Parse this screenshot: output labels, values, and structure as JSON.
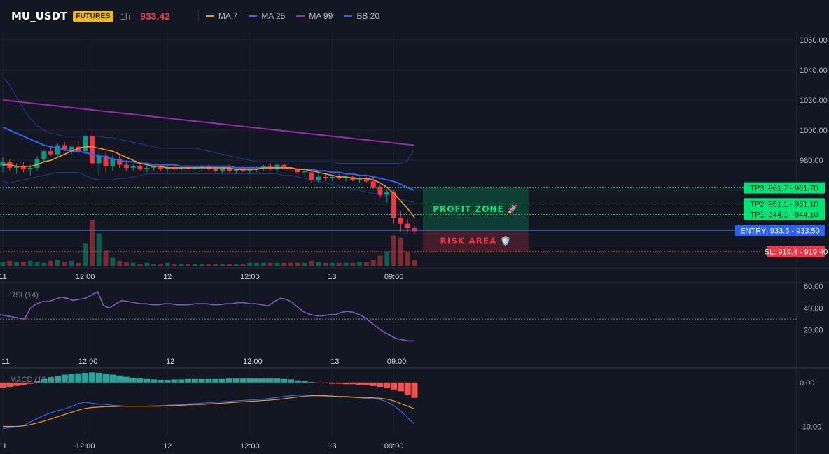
{
  "header": {
    "symbol": "MU_USDT",
    "badge": "FUTURES",
    "timeframe": "1h",
    "price": "933.42",
    "legend": [
      {
        "label": "MA 7",
        "color": "#f7931a"
      },
      {
        "label": "MA 25",
        "color": "#2962ff"
      },
      {
        "label": "MA 99",
        "color": "#9c27b0"
      },
      {
        "label": "BB 20",
        "color": "#2962ff"
      }
    ]
  },
  "colors": {
    "up": "#089981",
    "down": "#f23645",
    "volume_up": "#0b5e52",
    "volume_down": "#7a2a33",
    "ma7": "#f7931a",
    "ma25": "#2962ff",
    "ma99": "#9c27b0",
    "bb": "#1e3a8a",
    "rsi": "#7e57c2",
    "macd": "#2962ff",
    "signal": "#f7931a",
    "tp": "#00e676",
    "entry": "#2962ff",
    "sl": "#f23645"
  },
  "chart_data": [
    {
      "type": "candlestick",
      "panel": "price",
      "ylim": [
        910,
        1065
      ],
      "y_ticks": [
        960,
        980,
        1000,
        1020,
        1040,
        1060
      ],
      "y_tick_labels": [
        "960.00",
        "980.00",
        "1000.00",
        "1020.00",
        "1040.00",
        "1060.00"
      ],
      "x_tick_labels": [
        {
          "label": "11",
          "bar": 0
        },
        {
          "label": "12:00",
          "bar": 12
        },
        {
          "label": "12",
          "bar": 24
        },
        {
          "label": "12:00",
          "bar": 36
        },
        {
          "label": "13",
          "bar": 48
        },
        {
          "label": "09:00",
          "bar": 57
        }
      ],
      "candles": [
        {
          "o": 976,
          "h": 982,
          "l": 972,
          "c": 979
        },
        {
          "o": 979,
          "h": 981,
          "l": 973,
          "c": 975
        },
        {
          "o": 975,
          "h": 978,
          "l": 971,
          "c": 976
        },
        {
          "o": 976,
          "h": 979,
          "l": 972,
          "c": 974
        },
        {
          "o": 974,
          "h": 977,
          "l": 970,
          "c": 975
        },
        {
          "o": 975,
          "h": 983,
          "l": 973,
          "c": 981
        },
        {
          "o": 981,
          "h": 987,
          "l": 979,
          "c": 986
        },
        {
          "o": 986,
          "h": 989,
          "l": 983,
          "c": 984
        },
        {
          "o": 984,
          "h": 991,
          "l": 982,
          "c": 990
        },
        {
          "o": 990,
          "h": 992,
          "l": 986,
          "c": 987
        },
        {
          "o": 987,
          "h": 990,
          "l": 984,
          "c": 989
        },
        {
          "o": 989,
          "h": 993,
          "l": 984,
          "c": 986
        },
        {
          "o": 986,
          "h": 999,
          "l": 984,
          "c": 996
        },
        {
          "o": 996,
          "h": 1000,
          "l": 975,
          "c": 978
        },
        {
          "o": 978,
          "h": 988,
          "l": 970,
          "c": 983
        },
        {
          "o": 983,
          "h": 986,
          "l": 972,
          "c": 976
        },
        {
          "o": 976,
          "h": 983,
          "l": 973,
          "c": 981
        },
        {
          "o": 981,
          "h": 983,
          "l": 975,
          "c": 977
        },
        {
          "o": 977,
          "h": 980,
          "l": 973,
          "c": 975
        },
        {
          "o": 975,
          "h": 978,
          "l": 973,
          "c": 976
        },
        {
          "o": 976,
          "h": 978,
          "l": 973,
          "c": 974
        },
        {
          "o": 974,
          "h": 977,
          "l": 972,
          "c": 975
        },
        {
          "o": 975,
          "h": 977,
          "l": 973,
          "c": 976
        },
        {
          "o": 976,
          "h": 977,
          "l": 973,
          "c": 974
        },
        {
          "o": 974,
          "h": 977,
          "l": 972,
          "c": 975
        },
        {
          "o": 975,
          "h": 977,
          "l": 973,
          "c": 974
        },
        {
          "o": 974,
          "h": 976,
          "l": 972,
          "c": 975
        },
        {
          "o": 975,
          "h": 977,
          "l": 973,
          "c": 974
        },
        {
          "o": 974,
          "h": 976,
          "l": 972,
          "c": 975
        },
        {
          "o": 975,
          "h": 977,
          "l": 973,
          "c": 976
        },
        {
          "o": 976,
          "h": 977,
          "l": 973,
          "c": 974
        },
        {
          "o": 974,
          "h": 976,
          "l": 972,
          "c": 973
        },
        {
          "o": 973,
          "h": 976,
          "l": 971,
          "c": 975
        },
        {
          "o": 975,
          "h": 977,
          "l": 972,
          "c": 973
        },
        {
          "o": 973,
          "h": 975,
          "l": 971,
          "c": 974
        },
        {
          "o": 974,
          "h": 976,
          "l": 972,
          "c": 973
        },
        {
          "o": 973,
          "h": 975,
          "l": 971,
          "c": 974
        },
        {
          "o": 974,
          "h": 976,
          "l": 972,
          "c": 975
        },
        {
          "o": 975,
          "h": 977,
          "l": 973,
          "c": 976
        },
        {
          "o": 976,
          "h": 978,
          "l": 973,
          "c": 974
        },
        {
          "o": 974,
          "h": 978,
          "l": 972,
          "c": 977
        },
        {
          "o": 977,
          "h": 978,
          "l": 973,
          "c": 975
        },
        {
          "o": 975,
          "h": 977,
          "l": 972,
          "c": 974
        },
        {
          "o": 974,
          "h": 976,
          "l": 971,
          "c": 972
        },
        {
          "o": 972,
          "h": 975,
          "l": 969,
          "c": 973
        },
        {
          "o": 972,
          "h": 974,
          "l": 965,
          "c": 967
        },
        {
          "o": 967,
          "h": 971,
          "l": 965,
          "c": 969
        },
        {
          "o": 969,
          "h": 971,
          "l": 966,
          "c": 968
        },
        {
          "o": 968,
          "h": 970,
          "l": 966,
          "c": 969
        },
        {
          "o": 969,
          "h": 971,
          "l": 967,
          "c": 968
        },
        {
          "o": 968,
          "h": 970,
          "l": 966,
          "c": 969
        },
        {
          "o": 969,
          "h": 970,
          "l": 966,
          "c": 967
        },
        {
          "o": 967,
          "h": 969,
          "l": 965,
          "c": 968
        },
        {
          "o": 968,
          "h": 969,
          "l": 965,
          "c": 966
        },
        {
          "o": 966,
          "h": 969,
          "l": 961,
          "c": 962
        },
        {
          "o": 962,
          "h": 964,
          "l": 955,
          "c": 957
        },
        {
          "o": 957,
          "h": 961,
          "l": 952,
          "c": 959
        },
        {
          "o": 959,
          "h": 960,
          "l": 938,
          "c": 942
        },
        {
          "o": 942,
          "h": 946,
          "l": 933,
          "c": 938
        },
        {
          "o": 938,
          "h": 941,
          "l": 932,
          "c": 935
        },
        {
          "o": 935,
          "h": 937,
          "l": 931,
          "c": 933
        }
      ],
      "ma7": [
        977,
        977,
        976,
        976,
        976,
        977,
        979,
        980,
        982,
        984,
        986,
        988,
        989,
        989,
        988,
        987,
        986,
        984,
        982,
        980,
        978,
        977,
        976,
        976,
        975,
        975,
        975,
        975,
        975,
        975,
        975,
        975,
        975,
        975,
        974,
        974,
        974,
        974,
        975,
        975,
        975,
        975,
        975,
        974,
        974,
        973,
        972,
        971,
        970,
        969,
        969,
        968,
        968,
        968,
        967,
        965,
        962,
        958,
        953,
        948,
        942
      ],
      "ma25": [
        1002,
        1000,
        998,
        996,
        994,
        992,
        990,
        989,
        988,
        987,
        986,
        986,
        985,
        984,
        983,
        982,
        981,
        980,
        979,
        979,
        978,
        978,
        977,
        977,
        977,
        977,
        976,
        976,
        976,
        976,
        976,
        976,
        976,
        976,
        975,
        975,
        975,
        975,
        975,
        975,
        975,
        975,
        975,
        974,
        974,
        974,
        973,
        973,
        972,
        972,
        971,
        971,
        970,
        970,
        969,
        968,
        967,
        966,
        964,
        962,
        960
      ],
      "ma99": [
        1020,
        1019.5,
        1019,
        1018.5,
        1018,
        1017.5,
        1017,
        1016.5,
        1016,
        1015.5,
        1015,
        1014.5,
        1014,
        1013.5,
        1013,
        1012.5,
        1012,
        1011.5,
        1011,
        1010.5,
        1010,
        1009.5,
        1009,
        1008.5,
        1008,
        1007.5,
        1007,
        1006.5,
        1006,
        1005.5,
        1005,
        1004.5,
        1004,
        1003.5,
        1003,
        1002.5,
        1002,
        1001.5,
        1001,
        1000.5,
        1000,
        999.5,
        999,
        998.5,
        998,
        997.5,
        997,
        996.5,
        996,
        995.5,
        995,
        994.5,
        994,
        993.5,
        993,
        992.5,
        992,
        991.5,
        991,
        990.5,
        990
      ],
      "bb_upper": [
        1035,
        1030,
        1022,
        1014,
        1008,
        1003,
        1000,
        998,
        997,
        996,
        996,
        996,
        996,
        996,
        996,
        995,
        995,
        994,
        993,
        992,
        991,
        990,
        989,
        988,
        988,
        988,
        988,
        988,
        988,
        987,
        986,
        985,
        984,
        983,
        982,
        981,
        980,
        979,
        979,
        979,
        979,
        979,
        979,
        979,
        979,
        979,
        979,
        979,
        979,
        978,
        978,
        978,
        978,
        978,
        978,
        978,
        978,
        978,
        978,
        980,
        988
      ],
      "bb_lower": [
        966,
        965,
        966,
        967,
        968,
        969,
        970,
        971,
        972,
        972,
        972,
        972,
        970,
        968,
        967,
        967,
        967,
        968,
        968,
        969,
        970,
        971,
        971,
        971,
        971,
        971,
        971,
        971,
        971,
        971,
        971,
        971,
        971,
        971,
        971,
        971,
        971,
        971,
        971,
        971,
        971,
        970,
        970,
        969,
        968,
        967,
        966,
        965,
        964,
        963,
        962,
        961,
        960,
        959,
        958,
        957,
        956,
        955,
        954,
        953,
        952
      ],
      "volume": [
        4,
        5,
        4,
        4,
        5,
        4,
        3,
        5,
        6,
        4,
        5,
        3,
        22,
        45,
        32,
        15,
        8,
        5,
        4,
        3,
        2,
        3,
        2,
        2,
        3,
        2,
        2,
        2,
        2,
        2,
        2,
        2,
        2,
        2,
        2,
        2,
        3,
        3,
        3,
        3,
        3,
        3,
        3,
        3,
        3,
        5,
        4,
        3,
        3,
        3,
        3,
        3,
        4,
        4,
        6,
        10,
        14,
        30,
        28,
        14,
        6
      ],
      "levels": [
        {
          "name": "TP3",
          "value": 961.7,
          "label": "TP3: 961.7  -  961.70"
        },
        {
          "name": "TP2",
          "value": 951.1,
          "label": "TP2: 951.1  -  951.10"
        },
        {
          "name": "TP1",
          "value": 944.1,
          "label": "TP1: 944.1  -  944.10"
        },
        {
          "name": "ENTRY",
          "value": 933.5,
          "label": "ENTRY: 933.5  -  933.50"
        },
        {
          "name": "SL",
          "value": 919.4,
          "label": "SL: 919.4  -  919.40"
        }
      ],
      "zones": {
        "profit": "PROFIT ZONE 🚀",
        "risk": "RISK AREA 🛡️"
      }
    },
    {
      "type": "line",
      "panel": "rsi",
      "title": "RSI (14)",
      "ylim": [
        0,
        62
      ],
      "y_ticks": [
        20,
        40,
        60
      ],
      "y_tick_labels": [
        "20.00",
        "40.00",
        "60.00"
      ],
      "reference": 30,
      "values": [
        34,
        33,
        32,
        31,
        30,
        40,
        44,
        46,
        46,
        48,
        50,
        49,
        47,
        48,
        49,
        52,
        55,
        42,
        40,
        44,
        47,
        46,
        45,
        44,
        44,
        43,
        43,
        44,
        44,
        43,
        43,
        43,
        44,
        44,
        44,
        43,
        43,
        44,
        44,
        45,
        45,
        44,
        44,
        43,
        42,
        46,
        49,
        48,
        45,
        40,
        36,
        34,
        33,
        33,
        34,
        34,
        36,
        37,
        36,
        34,
        31,
        26,
        22,
        18,
        15,
        12,
        11,
        10,
        10
      ],
      "x_tick_labels": [
        {
          "label": "11",
          "bar": 0
        },
        {
          "label": "12:00",
          "bar": 12
        },
        {
          "label": "12",
          "bar": 24
        },
        {
          "label": "12:00",
          "bar": 36
        },
        {
          "label": "13",
          "bar": 48
        },
        {
          "label": "09:00",
          "bar": 57
        }
      ]
    },
    {
      "type": "bar+line",
      "panel": "macd",
      "title": "MACD (12, 26, 9)",
      "ylim": [
        -12,
        3
      ],
      "y_ticks": [
        -10,
        0
      ],
      "y_tick_labels": [
        "-10.00",
        "0.00"
      ],
      "histogram": [
        -1.2,
        -1.0,
        -0.8,
        -0.6,
        -0.3,
        0.3,
        0.8,
        1.2,
        1.5,
        1.8,
        2.0,
        2.1,
        2.2,
        2.3,
        2.2,
        2.0,
        1.8,
        1.6,
        1.3,
        1.1,
        0.9,
        0.8,
        0.7,
        0.6,
        0.6,
        0.7,
        0.7,
        0.8,
        0.8,
        0.8,
        0.8,
        0.8,
        0.8,
        0.9,
        0.9,
        0.9,
        0.9,
        0.9,
        0.9,
        0.9,
        0.9,
        0.8,
        0.7,
        0.5,
        0.3,
        0.1,
        -0.1,
        -0.2,
        -0.3,
        -0.3,
        -0.4,
        -0.4,
        -0.5,
        -0.6,
        -0.8,
        -1.0,
        -1.3,
        -1.6,
        -2.0,
        -2.8,
        -3.5
      ],
      "macd": [
        -10.5,
        -10.3,
        -10.2,
        -9.8,
        -9.0,
        -8.2,
        -7.5,
        -6.9,
        -6.4,
        -6.0,
        -5.5,
        -4.8,
        -4.5,
        -4.7,
        -4.9,
        -5.0,
        -5.2,
        -5.3,
        -5.4,
        -5.4,
        -5.4,
        -5.4,
        -5.3,
        -5.3,
        -5.2,
        -5.1,
        -5.0,
        -4.9,
        -4.8,
        -4.7,
        -4.6,
        -4.5,
        -4.4,
        -4.3,
        -4.2,
        -4.1,
        -4.0,
        -3.9,
        -3.8,
        -3.6,
        -3.4,
        -3.2,
        -3.0,
        -2.9,
        -2.8,
        -2.9,
        -3.0,
        -3.1,
        -3.2,
        -3.3,
        -3.3,
        -3.4,
        -3.5,
        -3.6,
        -3.7,
        -3.9,
        -4.4,
        -5.3,
        -6.5,
        -8.0,
        -9.5
      ],
      "signal": [
        -10.0,
        -10.0,
        -10.0,
        -9.9,
        -9.6,
        -9.2,
        -8.8,
        -8.3,
        -7.8,
        -7.3,
        -6.8,
        -6.3,
        -5.9,
        -5.7,
        -5.6,
        -5.5,
        -5.5,
        -5.4,
        -5.4,
        -5.4,
        -5.4,
        -5.4,
        -5.4,
        -5.4,
        -5.3,
        -5.3,
        -5.2,
        -5.1,
        -5.0,
        -5.0,
        -4.9,
        -4.8,
        -4.7,
        -4.6,
        -4.5,
        -4.4,
        -4.3,
        -4.2,
        -4.1,
        -4.0,
        -3.9,
        -3.7,
        -3.5,
        -3.3,
        -3.1,
        -3.0,
        -3.0,
        -3.0,
        -3.1,
        -3.2,
        -3.2,
        -3.3,
        -3.4,
        -3.4,
        -3.5,
        -3.6,
        -3.8,
        -4.2,
        -4.8,
        -5.4,
        -6.0
      ],
      "x_tick_labels": [
        {
          "label": "11",
          "bar": 0
        },
        {
          "label": "12:00",
          "bar": 12
        },
        {
          "label": "12",
          "bar": 24
        },
        {
          "label": "12:00",
          "bar": 36
        },
        {
          "label": "13",
          "bar": 48
        },
        {
          "label": "09:00",
          "bar": 57
        }
      ]
    }
  ]
}
